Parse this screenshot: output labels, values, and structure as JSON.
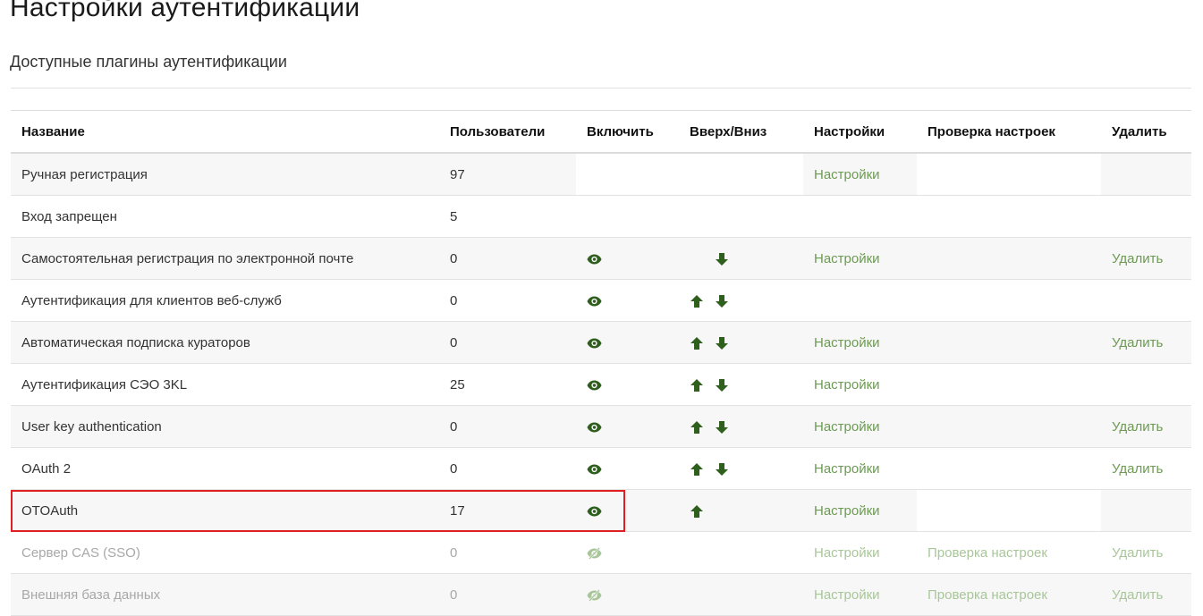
{
  "page": {
    "title": "Настройки аутентификации",
    "section_title": "Доступные плагины аутентификации"
  },
  "table": {
    "headers": {
      "name": "Название",
      "users": "Пользователи",
      "enable": "Включить",
      "updown": "Вверх/Вниз",
      "settings": "Настройки",
      "test": "Проверка настроек",
      "delete": "Удалить"
    },
    "rows": [
      {
        "name": "Ручная регистрация",
        "users": "97",
        "eye": "none",
        "up": false,
        "down": false,
        "settings": "Настройки",
        "test": "",
        "delete": "",
        "disabled": false
      },
      {
        "name": "Вход запрещен",
        "users": "5",
        "eye": "none",
        "up": false,
        "down": false,
        "settings": "",
        "test": "",
        "delete": "",
        "disabled": false
      },
      {
        "name": "Самостоятельная регистрация по электронной почте",
        "users": "0",
        "eye": "visible",
        "up": false,
        "down": true,
        "settings": "Настройки",
        "test": "",
        "delete": "Удалить",
        "disabled": false
      },
      {
        "name": "Аутентификация для клиентов веб-служб",
        "users": "0",
        "eye": "visible",
        "up": true,
        "down": true,
        "settings": "",
        "test": "",
        "delete": "",
        "disabled": false
      },
      {
        "name": "Автоматическая подписка кураторов",
        "users": "0",
        "eye": "visible",
        "up": true,
        "down": true,
        "settings": "Настройки",
        "test": "",
        "delete": "Удалить",
        "disabled": false
      },
      {
        "name": "Аутентификация СЭО 3KL",
        "users": "25",
        "eye": "visible",
        "up": true,
        "down": true,
        "settings": "Настройки",
        "test": "",
        "delete": "",
        "disabled": false
      },
      {
        "name": "User key authentication",
        "users": "0",
        "eye": "visible",
        "up": true,
        "down": true,
        "settings": "Настройки",
        "test": "",
        "delete": "Удалить",
        "disabled": false
      },
      {
        "name": "OAuth 2",
        "users": "0",
        "eye": "visible",
        "up": true,
        "down": true,
        "settings": "Настройки",
        "test": "",
        "delete": "Удалить",
        "disabled": false
      },
      {
        "name": "OTOAuth",
        "users": "17",
        "eye": "visible",
        "up": true,
        "down": false,
        "settings": "Настройки",
        "test": "",
        "delete": "",
        "disabled": false
      },
      {
        "name": "Сервер CAS (SSO)",
        "users": "0",
        "eye": "hidden",
        "up": false,
        "down": false,
        "settings": "Настройки",
        "test": "Проверка настроек",
        "delete": "Удалить",
        "disabled": true
      },
      {
        "name": "Внешняя база данных",
        "users": "0",
        "eye": "hidden",
        "up": false,
        "down": false,
        "settings": "Настройки",
        "test": "Проверка настроек",
        "delete": "Удалить",
        "disabled": true
      }
    ]
  },
  "colors": {
    "link": "#6d9a54",
    "icon": "#2f5f1d",
    "highlight": "#e02020"
  },
  "icons": {
    "enable": "eye-icon",
    "disabled": "eye-slash-icon",
    "up": "arrow-up-icon",
    "down": "arrow-down-icon"
  }
}
